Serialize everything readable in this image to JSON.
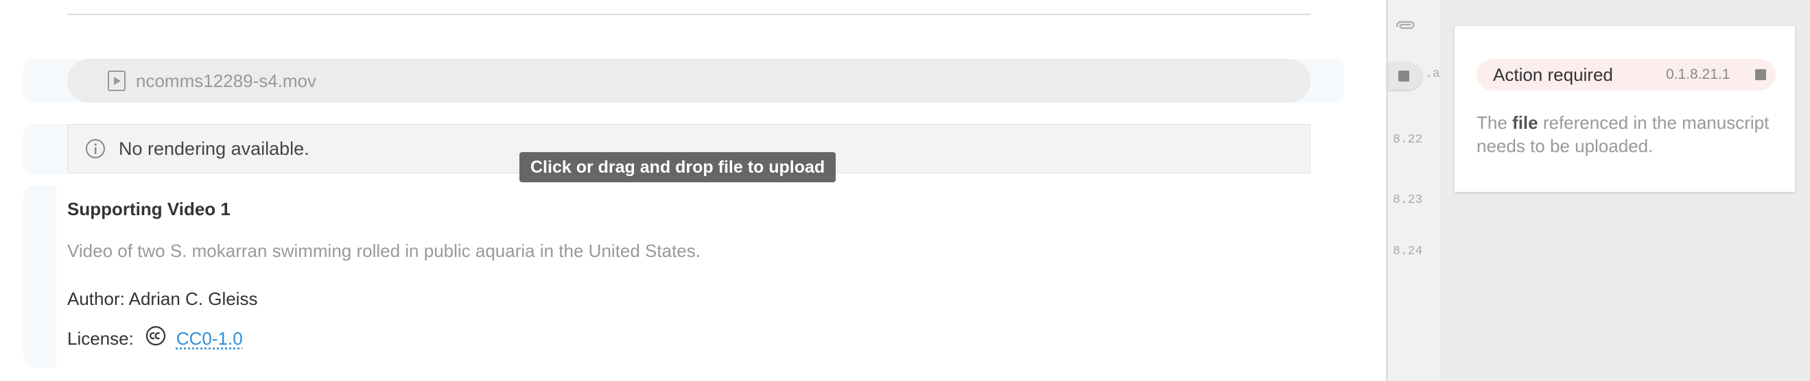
{
  "attachment": {
    "file_name": "ncomms12289-s4.mov",
    "file_icon": "play-file-icon"
  },
  "notice": {
    "icon": "info-icon",
    "text": "No rendering available."
  },
  "tooltip": {
    "text": "Click or drag and drop file to upload"
  },
  "supporting_video": {
    "title": "Supporting Video 1",
    "description": "Video of two S. mokarran swimming rolled in public aquaria in the United States.",
    "author": "Author: Adrian C. Gleiss",
    "license_label": "License:",
    "license_icon": "creative-commons-icon",
    "license_value": "CC0-1.0"
  },
  "gutter": {
    "clip_icon": "paperclip-icon",
    "labels": [
      ".a",
      "8.22",
      "8.23",
      "8.24"
    ]
  },
  "action_card": {
    "status": "Action required",
    "code": "0.1.8.21.1",
    "message_prefix": "The ",
    "message_bold": "file",
    "message_suffix": " referenced in the manuscript needs to be uploaded."
  },
  "colors": {
    "accent_link": "#2f8fd6",
    "action_bg": "#fdeeee",
    "tooltip_bg": "#666666"
  }
}
